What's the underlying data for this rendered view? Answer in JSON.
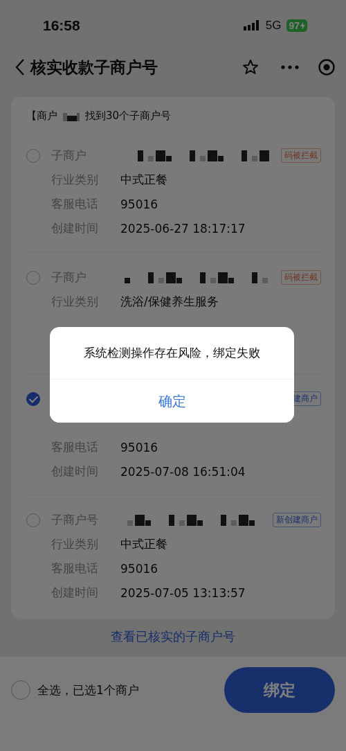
{
  "status_bar": {
    "time": "16:58",
    "network": "5G",
    "battery": "97"
  },
  "nav": {
    "title": "核实收款子商户号"
  },
  "summary": {
    "prefix": "【商户",
    "suffix": "找到30个子商户号"
  },
  "merchants": [
    {
      "selected": false,
      "label": "子商户",
      "tag": {
        "text": "码被拦截",
        "kind": "blocked"
      },
      "industry": {
        "label": "行业类别",
        "value": "中式正餐"
      },
      "phone": {
        "label": "客服电话",
        "value": "95016"
      },
      "created": {
        "label": "创建时间",
        "value": "2025-06-27 18:17:17"
      }
    },
    {
      "selected": false,
      "label": "子商户",
      "tag": {
        "text": "码被拦截",
        "kind": "blocked"
      },
      "industry": {
        "label": "行业类别",
        "value": "洗浴/保健养生服务"
      }
    },
    {
      "selected": true,
      "tag": {
        "text": "建商户",
        "kind": "new"
      },
      "phone": {
        "label": "客服电话",
        "value": "95016"
      },
      "created": {
        "label": "创建时间",
        "value": "2025-07-08 16:51:04"
      }
    },
    {
      "selected": false,
      "label": "子商户号",
      "tag": {
        "text": "新创建商户",
        "kind": "new"
      },
      "industry": {
        "label": "行业类别",
        "value": "中式正餐"
      },
      "phone": {
        "label": "客服电话",
        "value": "95016"
      },
      "created": {
        "label": "创建时间",
        "value": "2025-07-05 13:13:57"
      }
    }
  ],
  "link": "查看已核实的子商户号",
  "footer": {
    "select_all": {
      "label": "全选，已选1个商户",
      "checked": false
    },
    "bind_button": "绑定"
  },
  "dialog": {
    "message": "系统检测操作存在风险，绑定失败",
    "confirm": "确定"
  }
}
